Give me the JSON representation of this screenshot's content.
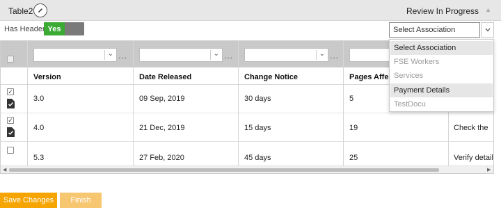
{
  "panel": {
    "table_name": "Table2",
    "status": "Review In Progress"
  },
  "has_header": {
    "label": "Has Header",
    "value": "Yes"
  },
  "association": {
    "selected": "Select Association",
    "options": [
      "Select Association",
      "FSE Workers",
      "Services",
      "Payment Details",
      "TestDocu"
    ]
  },
  "table": {
    "columns": [
      "Version",
      "Date Released",
      "Change Notice",
      "Pages Affect"
    ],
    "filter_more": "...",
    "rows": [
      {
        "checked": true,
        "version": "3.0",
        "date": "09 Sep, 2019",
        "notice": "30 days",
        "pages": "5",
        "extra": ""
      },
      {
        "checked": true,
        "version": "4.0",
        "date": "21 Dec, 2019",
        "notice": "15 days",
        "pages": "19",
        "extra": "Check the"
      },
      {
        "checked": false,
        "version": "5.3",
        "date": "27 Feb, 2020",
        "notice": "45 days",
        "pages": "25",
        "extra": "Verify details"
      }
    ]
  },
  "actions": {
    "save": "Save Changes",
    "finish": "Finish"
  },
  "colors": {
    "toggle_on": "#3aaa35",
    "toggle_off": "#7a7a7a",
    "save_button": "#f5a400",
    "finish_button": "#f7c670",
    "filter_row": "#c9c9c9",
    "topbar": "#e7e7e7"
  },
  "icons": [
    "pencil-icon",
    "chevron-down-icon",
    "chevron-up-icon",
    "document-check-icon",
    "checkbox-icon",
    "ellipsis-icon",
    "scroll-left-icon",
    "scroll-right-icon"
  ]
}
